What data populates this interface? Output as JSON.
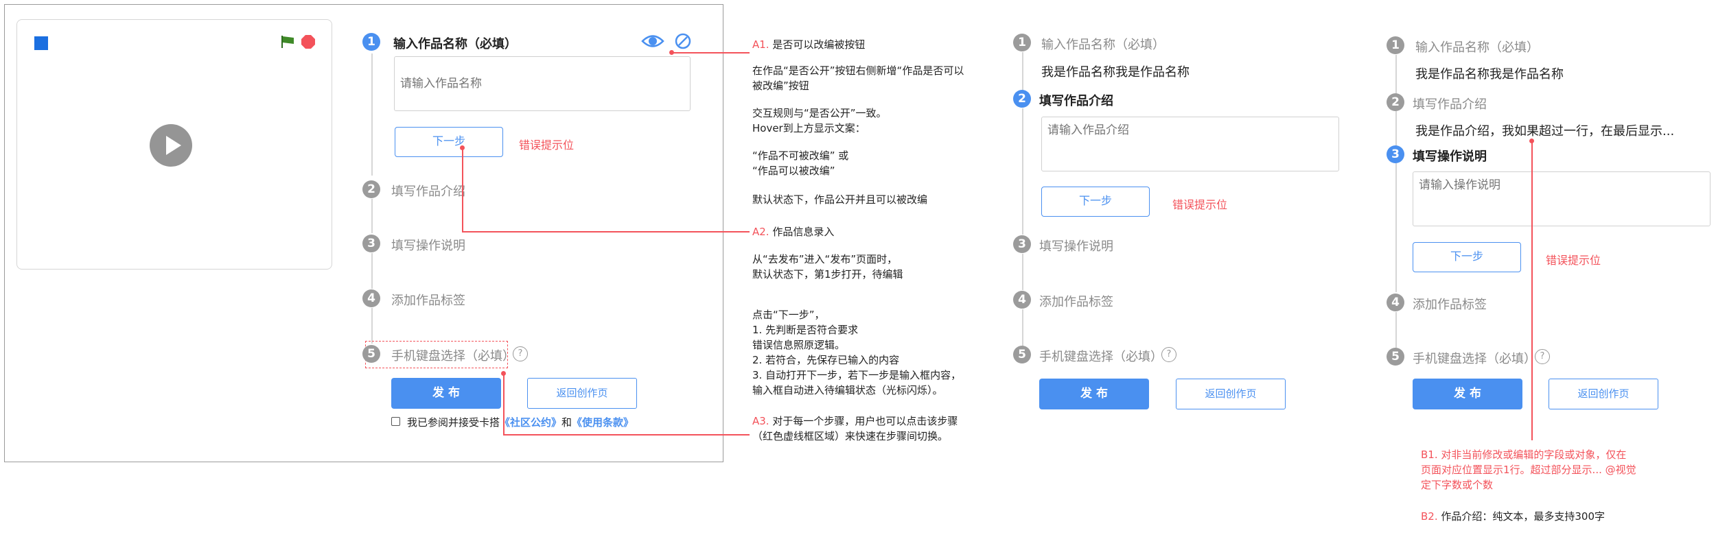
{
  "step1": {
    "num": "1",
    "label": "输入作品名称（必填）",
    "placeholder": "请输入作品名称"
  },
  "step2": {
    "num": "2",
    "label": "填写作品介绍",
    "placeholder": "请输入作品介绍"
  },
  "step3": {
    "num": "3",
    "label": "填写操作说明",
    "placeholder": "请输入操作说明"
  },
  "step4": {
    "num": "4",
    "label": "添加作品标签"
  },
  "step5": {
    "num": "5",
    "label": "手机键盘选择（必填）",
    "help": "?"
  },
  "next_label": "下一步",
  "error_hint": "错误提示位",
  "publish_label": "发 布",
  "return_label": "返回创作页",
  "agree": {
    "pre": "我已参阅并接受卡搭",
    "link1": "《社区公约》",
    "mid": "和",
    "link2": "《使用条款》"
  },
  "values": {
    "name": "我是作品名称我是作品名称",
    "intro": "我是作品介绍，我如果超过一行，在最后显示..."
  },
  "notes": {
    "a1_tag": "A1.",
    "a1": "是否可以改编被按钮",
    "a1_l1": "在作品“是否公开”按钮右侧新增“作品是否可以",
    "a1_l2": "被改编”按钮",
    "a1_l3": "交互规则与“是否公开”一致。",
    "a1_l4": "Hover到上方显示文案：",
    "a1_l5": "“作品不可被改编” 或",
    "a1_l6": "“作品可以被改编”",
    "a1_l7": "默认状态下，作品公开并且可以被改编",
    "a2_tag": "A2.",
    "a2": "作品信息录入",
    "a2_l1": "从“去发布”进入“发布”页面时，",
    "a2_l2": "默认状态下，第1步打开，待编辑",
    "a2_l3": "点击“下一步”，",
    "a2_l4": "1. 先判断是否符合要求",
    "a2_l5": "错误信息照原逻辑。",
    "a2_l6": "2. 若符合，先保存已输入的内容",
    "a2_l7": "3. 自动打开下一步，若下一步是输入框内容，",
    "a2_l8": "输入框自动进入待编辑状态（光标闪烁）。",
    "a3_tag": "A3.",
    "a3": "对于每一个步骤，用户也可以点击该步骤",
    "a3_l2": "（红色虚线框区域）来快速在步骤间切换。",
    "b1_tag": "B1.",
    "b1": "对非当前修改或编辑的字段或对象，仅在",
    "b1_l2": "页面对应位置显示1行。超过部分显示...",
    "b1_l2b": "@视觉",
    "b1_l3": "定下字数或个数",
    "b2_tag": "B2.",
    "b2": "作品介绍：纯文本，最多支持300字"
  },
  "colors": {
    "accent": "#4a90f0",
    "error": "#f3525a",
    "stage_blue": "#1b6fe0"
  }
}
